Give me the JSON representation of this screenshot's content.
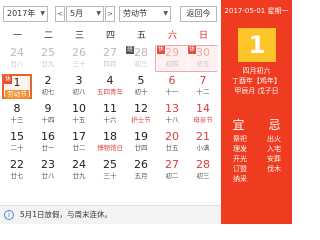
{
  "toolbar": {
    "year": "2017年",
    "month": "5月",
    "holiday": "劳动节",
    "today_btn": "返回今",
    "dropdown_icon": "chevron-down-icon",
    "prev_icon": "chevron-left-icon",
    "next_icon": "chevron-right-icon"
  },
  "weekdays": [
    "一",
    "二",
    "三",
    "四",
    "五",
    "六",
    "日"
  ],
  "tags": {
    "rest": "休",
    "work": "班"
  },
  "calendar": [
    [
      {
        "d": "24",
        "l": "廿八"
      },
      {
        "d": "25",
        "l": "廿九"
      },
      {
        "d": "26",
        "l": "三十"
      },
      {
        "d": "27",
        "l": "四月"
      },
      {
        "d": "28",
        "l": "初三"
      },
      {
        "d": "29",
        "l": "初四"
      },
      {
        "d": "30",
        "l": "初五"
      }
    ],
    [
      {
        "d": "1",
        "l": "劳动节"
      },
      {
        "d": "2",
        "l": "初七"
      },
      {
        "d": "3",
        "l": "初八"
      },
      {
        "d": "4",
        "l": "五四青年"
      },
      {
        "d": "5",
        "l": "初十"
      },
      {
        "d": "6",
        "l": "十一"
      },
      {
        "d": "7",
        "l": "十二"
      }
    ],
    [
      {
        "d": "8",
        "l": "十三"
      },
      {
        "d": "9",
        "l": "十四"
      },
      {
        "d": "10",
        "l": "十五"
      },
      {
        "d": "11",
        "l": "十六"
      },
      {
        "d": "12",
        "l": "护士节"
      },
      {
        "d": "13",
        "l": "十八"
      },
      {
        "d": "14",
        "l": "母亲节"
      }
    ],
    [
      {
        "d": "15",
        "l": "二十"
      },
      {
        "d": "16",
        "l": "廿一"
      },
      {
        "d": "17",
        "l": "廿二"
      },
      {
        "d": "18",
        "l": "博物馆日"
      },
      {
        "d": "19",
        "l": "廿四"
      },
      {
        "d": "20",
        "l": "廿五"
      },
      {
        "d": "21",
        "l": "小满"
      }
    ],
    [
      {
        "d": "22",
        "l": "廿七"
      },
      {
        "d": "23",
        "l": "廿八"
      },
      {
        "d": "24",
        "l": "廿九"
      },
      {
        "d": "25",
        "l": "三十"
      },
      {
        "d": "26",
        "l": "五月"
      },
      {
        "d": "27",
        "l": "初二"
      },
      {
        "d": "28",
        "l": "初三"
      }
    ]
  ],
  "sidebar": {
    "date_line": "2017-05-01 星期一",
    "big_day": "1",
    "lunar_lines": [
      "四月初六",
      "丁酉年【鸡年】",
      "甲辰月 戊子日"
    ],
    "yi": "宜",
    "ji": "忌",
    "yi_items": [
      "祭祀",
      "理发",
      "开光",
      "订盟",
      "纳采"
    ],
    "ji_items": [
      "出火",
      "入宅",
      "安葬",
      "伐木"
    ]
  },
  "notice": {
    "icon": "info-icon",
    "text": "5月1日放假，与周末连休。"
  },
  "colors": {
    "accent": "#ef3b20",
    "day_badge": "#fec52a",
    "today_border": "#e8632c"
  }
}
